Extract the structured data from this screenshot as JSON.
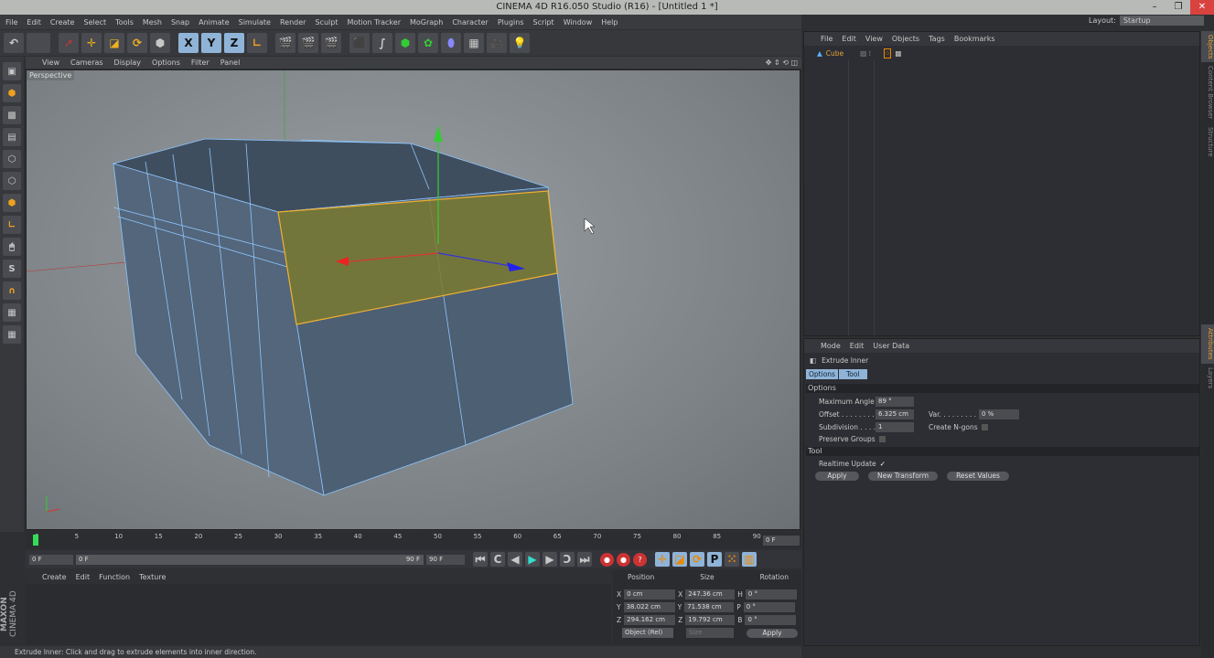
{
  "window": {
    "title": "CINEMA 4D R16.050 Studio (R16) - [Untitled 1 *]"
  },
  "menubar": [
    "File",
    "Edit",
    "Create",
    "Select",
    "Tools",
    "Mesh",
    "Snap",
    "Animate",
    "Simulate",
    "Render",
    "Sculpt",
    "Motion Tracker",
    "MoGraph",
    "Character",
    "Plugins",
    "Script",
    "Window",
    "Help"
  ],
  "layout": {
    "label": "Layout:",
    "value": "Startup"
  },
  "toolbar": {
    "x": "X",
    "y": "Y",
    "z": "Z"
  },
  "viewport": {
    "menu": [
      "View",
      "Cameras",
      "Display",
      "Options",
      "Filter",
      "Panel"
    ],
    "camera": "Perspective"
  },
  "timeline": {
    "ticks": [
      "0",
      "5",
      "10",
      "15",
      "20",
      "25",
      "30",
      "35",
      "40",
      "45",
      "50",
      "55",
      "60",
      "65",
      "70",
      "75",
      "80",
      "85",
      "90"
    ],
    "current": "0 F",
    "start": "0 F",
    "range_start": "0 F",
    "range_end": "90 F",
    "end": "90 F"
  },
  "materials": {
    "menu": [
      "Create",
      "Edit",
      "Function",
      "Texture"
    ]
  },
  "coords": {
    "headers": [
      "Position",
      "Size",
      "Rotation"
    ],
    "rows": [
      {
        "pl": "X",
        "p": "0 cm",
        "sl": "X",
        "s": "247.36 cm",
        "rl": "H",
        "r": "0 °"
      },
      {
        "pl": "Y",
        "p": "38.022 cm",
        "sl": "Y",
        "s": "71.538 cm",
        "rl": "P",
        "r": "0 °"
      },
      {
        "pl": "Z",
        "p": "294.162 cm",
        "sl": "Z",
        "s": "19.792 cm",
        "rl": "B",
        "r": "0 °"
      }
    ],
    "mode": "Object (Rel)",
    "size_mode": "Size",
    "apply": "Apply"
  },
  "brand": {
    "maxon": "MAXON",
    "product": "CINEMA 4D"
  },
  "status": "Extrude Inner: Click and drag to extrude elements into inner direction.",
  "objects": {
    "menu": [
      "File",
      "Edit",
      "View",
      "Objects",
      "Tags",
      "Bookmarks"
    ],
    "items": [
      {
        "name": "Cube"
      }
    ]
  },
  "attributes": {
    "menu": [
      "Mode",
      "Edit",
      "User Data"
    ],
    "tool_name": "Extrude Inner",
    "tabs": [
      "Options",
      "Tool"
    ],
    "options_header": "Options",
    "max_angle_label": "Maximum Angle",
    "max_angle": "89 °",
    "offset_label": "Offset . . . . . . . .",
    "offset": "6.325 cm",
    "var_label": "Var. . . . . . . . . .",
    "var": "0 %",
    "subdiv_label": "Subdivision . . . .",
    "subdiv": "1",
    "ngons_label": "Create N-gons",
    "preserve_label": "Preserve Groups",
    "tool_header": "Tool",
    "realtime_label": "Realtime Update",
    "realtime_check": "✓",
    "apply": "Apply",
    "new_transform": "New Transform",
    "reset": "Reset Values"
  },
  "side_tabs": [
    "Objects",
    "Content Browser",
    "Structure",
    "Attributes",
    "Layers"
  ]
}
